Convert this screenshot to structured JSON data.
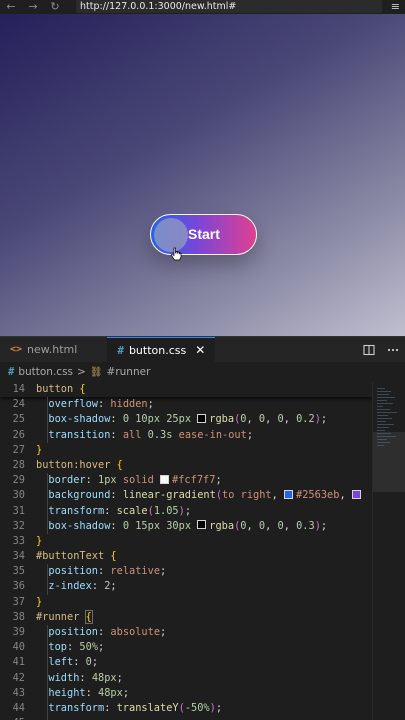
{
  "browser": {
    "back_icon": "←",
    "forward_icon": "→",
    "reload_icon": "↻",
    "url": "http://127.0.0.1:3000/new.html#",
    "menu_icon": "≡"
  },
  "preview": {
    "button_label": "Start"
  },
  "editor": {
    "tabs": [
      {
        "icon": "<>",
        "label": "new.html"
      },
      {
        "icon": "#",
        "label": "button.css",
        "close": "✕"
      }
    ],
    "breadcrumb": {
      "file": "button.css",
      "separator": ">",
      "symbol": "#runner"
    },
    "colors": {
      "swatch_black": "#000000",
      "swatch_white": "#fcf7f7",
      "swatch_blue": "#2563eb",
      "swatch_purple": "#7b46d8"
    }
  }
}
